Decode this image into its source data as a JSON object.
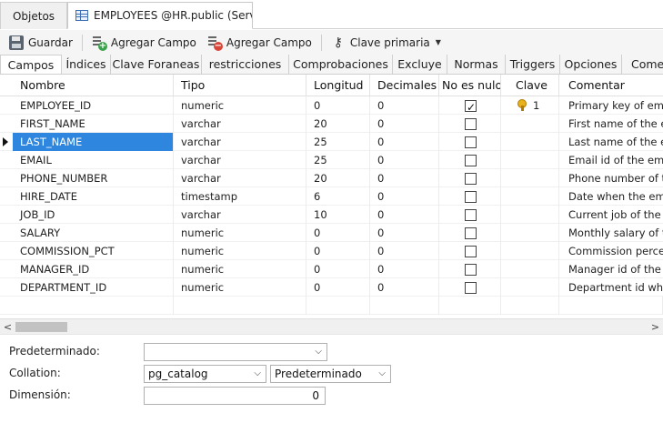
{
  "doc_tabs": {
    "objects": "Objetos",
    "table": "EMPLOYEES @HR.public (Serv..."
  },
  "toolbar": {
    "save": "Guardar",
    "add_field": "Agregar Campo",
    "delete_field": "Agregar Campo",
    "primary_key": "Clave primaria",
    "icons": [
      "save-icon",
      "add-field-icon",
      "delete-field-icon",
      "key-icon"
    ]
  },
  "sub_tabs": [
    "Campos",
    "Índices",
    "Clave Foraneas",
    "restricciones",
    "Comprobaciones",
    "Excluye",
    "Normas",
    "Triggers",
    "Opciones",
    "Come"
  ],
  "columns": [
    "Nombre",
    "Tipo",
    "Longitud",
    "Decimales",
    "No es nulo",
    "Clave",
    "Comentar"
  ],
  "rows": [
    {
      "name": "EMPLOYEE_ID",
      "type": "numeric",
      "length": "0",
      "decimals": "0",
      "not_null": true,
      "key": "1",
      "comment": "Primary key of emp"
    },
    {
      "name": "FIRST_NAME",
      "type": "varchar",
      "length": "20",
      "decimals": "0",
      "not_null": false,
      "key": "",
      "comment": "First name of the e"
    },
    {
      "name": "LAST_NAME",
      "type": "varchar",
      "length": "25",
      "decimals": "0",
      "not_null": false,
      "key": "",
      "comment": "Last name of the en"
    },
    {
      "name": "EMAIL",
      "type": "varchar",
      "length": "25",
      "decimals": "0",
      "not_null": false,
      "key": "",
      "comment": "Email id of the emp"
    },
    {
      "name": "PHONE_NUMBER",
      "type": "varchar",
      "length": "20",
      "decimals": "0",
      "not_null": false,
      "key": "",
      "comment": "Phone number of th"
    },
    {
      "name": "HIRE_DATE",
      "type": "timestamp",
      "length": "6",
      "decimals": "0",
      "not_null": false,
      "key": "",
      "comment": "Date when the emp"
    },
    {
      "name": "JOB_ID",
      "type": "varchar",
      "length": "10",
      "decimals": "0",
      "not_null": false,
      "key": "",
      "comment": "Current job of the e"
    },
    {
      "name": "SALARY",
      "type": "numeric",
      "length": "0",
      "decimals": "0",
      "not_null": false,
      "key": "",
      "comment": "Monthly salary of th"
    },
    {
      "name": "COMMISSION_PCT",
      "type": "numeric",
      "length": "0",
      "decimals": "0",
      "not_null": false,
      "key": "",
      "comment": "Commission percen"
    },
    {
      "name": "MANAGER_ID",
      "type": "numeric",
      "length": "0",
      "decimals": "0",
      "not_null": false,
      "key": "",
      "comment": "Manager id of the e"
    },
    {
      "name": "DEPARTMENT_ID",
      "type": "numeric",
      "length": "0",
      "decimals": "0",
      "not_null": false,
      "key": "",
      "comment": "Department id whe"
    }
  ],
  "selected_row_name": "LAST_NAME",
  "props": {
    "default_label": "Predeterminado:",
    "default_value": "",
    "collation_label": "Collation:",
    "collation_schema": "pg_catalog",
    "collation_value": "Predeterminado",
    "dimension_label": "Dimensión:",
    "dimension_value": "0"
  },
  "colors": {
    "selection": "#2e86de",
    "key": "#e8b21c"
  }
}
